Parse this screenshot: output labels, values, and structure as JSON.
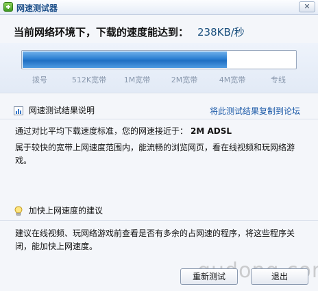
{
  "window": {
    "title": "网速测试器",
    "close_label": "✕"
  },
  "result": {
    "headline": "当前网络环境下，下载的速度能达到：",
    "speed": "238KB/秒",
    "progress_fraction": 0.75,
    "scale_labels": [
      "拨号",
      "512K宽带",
      "1M宽带",
      "2M宽带",
      "4M宽带",
      "专线"
    ]
  },
  "explanation": {
    "heading": "网速测试结果说明",
    "copy_link": "将此测试结果复制到论坛",
    "line1_prefix": "通过对比平均下载速度标准，您的网速接近于：",
    "line1_value": "2M ADSL",
    "line2": "属于较快的宽带上网速度范围内，能流畅的浏览网页，看在线视频和玩网络游戏。"
  },
  "advice": {
    "heading": "加快上网速度的建议",
    "text": "建议在线视频、玩网络游戏前查看是否有多余的占网速的程序，将这些程序关闭，能加快上网速度。"
  },
  "buttons": {
    "retest": "重新测试",
    "exit": "退出"
  },
  "watermark": "qudong.com",
  "colors": {
    "progress": "#2b7fd2",
    "link": "#1c5aa8",
    "speed": "#1a4f7d"
  }
}
